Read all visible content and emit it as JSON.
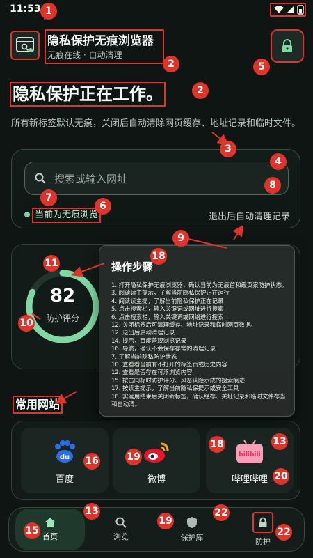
{
  "status": {
    "time": "11:53"
  },
  "header": {
    "app_title": "隐私保护无痕浏览器",
    "app_subtitle": "无痕在线 · 自动清理"
  },
  "hero": {
    "headline": "隐私保护正在工作。",
    "description": "所有新标签默认无痕，关闭后自动清除网页缓存、地址记录和临时文件。"
  },
  "search": {
    "placeholder": "搜索或输入网址",
    "mode_label": "当前为无痕浏览",
    "clear_label": "退出后自动清理记录"
  },
  "score": {
    "value": "82",
    "label": "防护评分",
    "fraction": 0.82
  },
  "popup": {
    "title": "操作步骤",
    "steps": [
      "1. 打开隐私保护无痕浏览器，确认当前为无痕首和缓页案防护状态。",
      "3. 阅读读主提示，了解当前隐私保护正在运行",
      "4. 阅读读主提，了解当前隐私保护正在记录",
      "5. 点击搜索栏，输入关键词或网址进行搜索",
      "6. 点击搜索栏，输入关键词或网络进行搜索",
      "12. 关闭标签后可清理缓存、地址记录和临时网页数据。",
      "12. 退出后启动清理记录",
      "14. 提示，百度普观浏览记录",
      "16. 导航，确认不会保存存常的清理记录",
      "7. 了解当前隐私防护状态",
      "10. 查看看当前有不打开的标签页或历史内容",
      "12. 查看是否存在可浮浏览内容",
      "15. 按击同标时防护评分、风恶认隐示成的搜索痕迹",
      "17. 按读主提示，了解当前隐私保提示或安全工具",
      "18. 实诞用结束后关闭新标签，确认经存、关址记录和临时文件存当和自动清。"
    ]
  },
  "sites": {
    "title": "常用网站",
    "items": [
      {
        "name": "百度",
        "logo": "du"
      },
      {
        "name": "微博",
        "logo": "weibo"
      },
      {
        "name": "哔哩哔哩",
        "logo": "bilibili"
      }
    ]
  },
  "nav": {
    "items": [
      {
        "label": "首页",
        "icon": "home-icon"
      },
      {
        "label": "浏览",
        "icon": "search-icon"
      },
      {
        "label": "保护库",
        "icon": "shield-icon"
      },
      {
        "label": "防护",
        "icon": "lock-icon"
      }
    ]
  },
  "badges": [
    "1",
    "2",
    "2",
    "3",
    "4",
    "5",
    "6",
    "7",
    "8",
    "9",
    "10",
    "11",
    "13",
    "13",
    "15",
    "16",
    "18",
    "18",
    "19",
    "19",
    "20",
    "22",
    "22"
  ],
  "colors": {
    "accent": "#7fd7a2",
    "annotation": "#e0342b",
    "background": "#0e1512"
  }
}
